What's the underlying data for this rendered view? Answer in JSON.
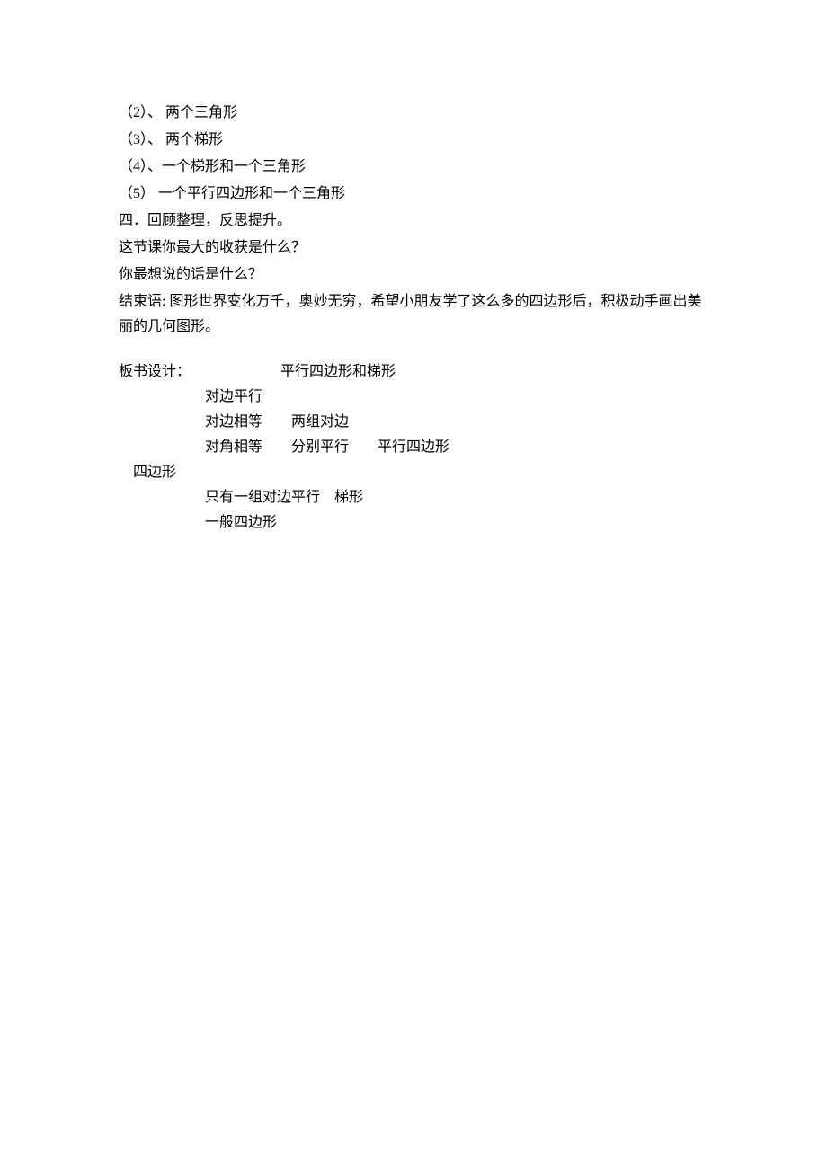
{
  "lines": {
    "l1": "（2）、 两个三角形",
    "l2": "（3）、 两个梯形",
    "l3": "（4）、一个梯形和一个三角形",
    "l4": "（5） 一个平行四边形和一个三角形",
    "l5": "四．回顾整理，反思提升。",
    "l6": "这节课你最大的收获是什么？",
    "l7": "你最想说的话是什么？",
    "l8": "结束语: 图形世界变化万千，奥妙无穷，希望小朋友学了这么多的四边形后，积极动手画出美丽的几何图形。"
  },
  "board": {
    "label": "板书设计：",
    "title": "平行四边形和梯形",
    "r1": "对边平行",
    "r2a": "对边相等",
    "r2b": "两组对边",
    "r3a": "对角相等",
    "r3b": "分别平行",
    "r3c": "平行四边形",
    "left": "四边形",
    "r4a": "只有一组对边平行",
    "r4b": "梯形",
    "r5": "一般四边形"
  }
}
